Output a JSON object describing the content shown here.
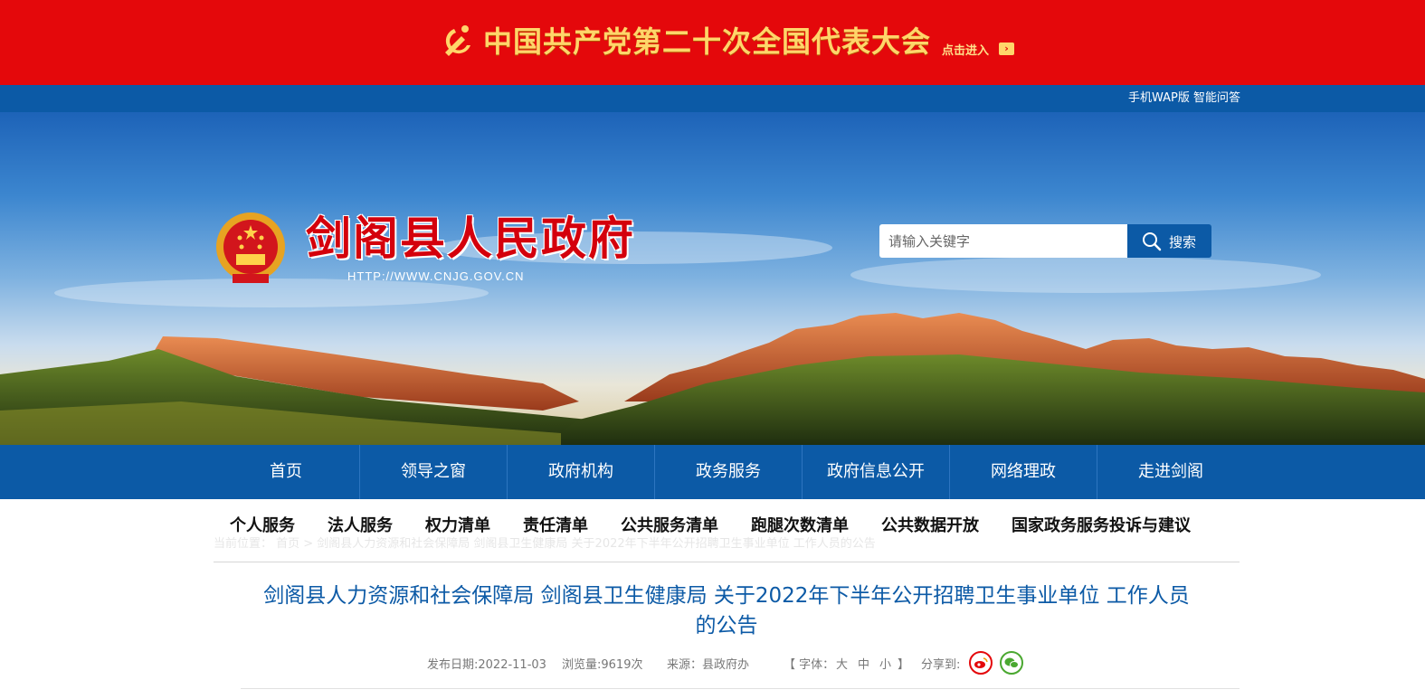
{
  "banner": {
    "title": "中国共产党第二十次全国代表大会",
    "enter_label": "点击进入",
    "enter_arrow": "›",
    "colors": {
      "background": "#e4080b",
      "text": "#ffd56a"
    }
  },
  "utility": {
    "links": [
      "手机WAP版",
      "智能问答"
    ]
  },
  "header": {
    "site_title": "剑阁县人民政府",
    "site_url": "HTTP://WWW.CNJG.GOV.CN",
    "search": {
      "placeholder": "请输入关键字",
      "button_label": "搜索"
    }
  },
  "main_nav": {
    "items": [
      "首页",
      "领导之窗",
      "政府机构",
      "政务服务",
      "政府信息公开",
      "网络理政",
      "走进剑阁"
    ]
  },
  "sub_nav": {
    "items": [
      "个人服务",
      "法人服务",
      "权力清单",
      "责任清单",
      "公共服务清单",
      "跑腿次数清单",
      "公共数据开放",
      "国家政务服务投诉与建议"
    ]
  },
  "breadcrumb": {
    "text": "当前位置： 首页 > 剑阁县人力资源和社会保障局 剑阁县卫生健康局 关于2022年下半年公开招聘卫生事业单位 工作人员的公告"
  },
  "article": {
    "title_line1": "剑阁县人力资源和社会保障局 剑阁县卫生健康局 关于2022年下半年公开招聘卫生事业单位 工作人员",
    "title_line2": "的公告",
    "publish_date": "发布日期:2022-11-03",
    "views": "浏览量:9619次",
    "source": "来源：县政府办",
    "font_label": "【 字体：",
    "font_large": "大",
    "font_medium": "中",
    "font_small": "小",
    "font_close": "】",
    "share_label": "分享到:",
    "share_icons": [
      "weibo-icon",
      "wechat-icon"
    ]
  },
  "colors": {
    "primary_blue": "#0c5aa6",
    "title_red": "#d4000c",
    "link_blue": "#0c5aa6"
  }
}
